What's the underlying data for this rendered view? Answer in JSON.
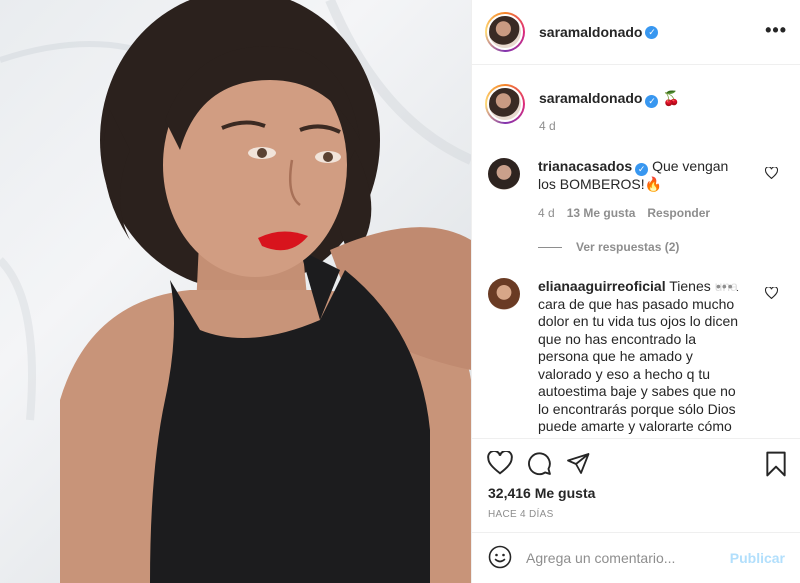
{
  "post": {
    "author": "saramaldonado",
    "caption_emoji": "🍒",
    "caption_time": "4 d"
  },
  "comments": [
    {
      "user": "trianacasados",
      "text": "Que vengan los BOMBEROS!🔥",
      "time": "4 d",
      "likes": "13 Me gusta",
      "reply_label": "Responder",
      "view_replies": "Ver respuestas (2)"
    },
    {
      "user": "elianaaguirreoficial",
      "text": "Tienes una cara de que has pasado mucho dolor en tu vida tus ojos lo dicen que no has encontrado la persona que he amado y valorado y eso a hecho q tu autoestima baje y sabes que no lo encontrarás porque sólo Dios puede amarte y valorarte cómo"
    }
  ],
  "overlay_dots": "•••",
  "likes_count": "32,416 Me gusta",
  "posted_ago": "HACE 4 DÍAS",
  "comment_box": {
    "placeholder": "Agrega un comentario...",
    "post_label": "Publicar"
  },
  "icons": {
    "more": "more-options-icon",
    "like": "heart-icon",
    "comment": "comment-icon",
    "share": "paper-plane-icon",
    "save": "bookmark-icon",
    "emoji": "emoji-icon",
    "verified": "verified-badge-icon"
  },
  "colors": {
    "verified": "#3897f0",
    "publish_disabled": "#b2dffc",
    "muted_text": "#8e8e8e",
    "lipstick": "#d8141d"
  }
}
